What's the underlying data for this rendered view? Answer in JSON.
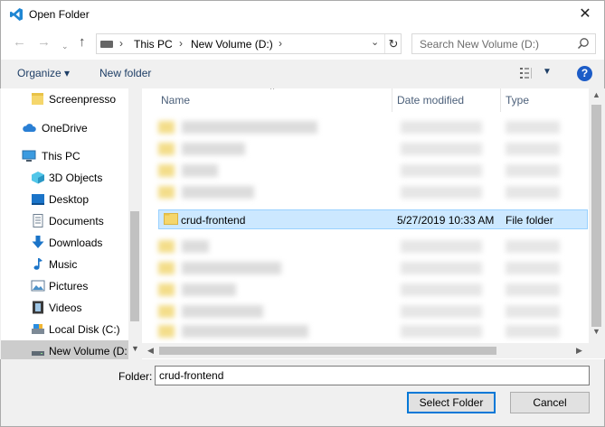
{
  "window": {
    "title": "Open Folder"
  },
  "address": {
    "crumbs": [
      "This PC",
      "New Volume (D:)"
    ],
    "search_placeholder": "Search New Volume (D:)"
  },
  "toolbar": {
    "organize": "Organize ▾",
    "new_folder": "New folder"
  },
  "nav": {
    "items": [
      {
        "label": "Screenpresso",
        "icon": "folder-icon"
      },
      {
        "label": "OneDrive",
        "icon": "cloud-icon"
      },
      {
        "label": "This PC",
        "icon": "computer-icon"
      },
      {
        "label": "3D Objects",
        "icon": "cube-icon"
      },
      {
        "label": "Desktop",
        "icon": "desktop-icon"
      },
      {
        "label": "Documents",
        "icon": "document-icon"
      },
      {
        "label": "Downloads",
        "icon": "download-arrow-icon"
      },
      {
        "label": "Music",
        "icon": "music-note-icon"
      },
      {
        "label": "Pictures",
        "icon": "pictures-icon"
      },
      {
        "label": "Videos",
        "icon": "film-icon"
      },
      {
        "label": "Local Disk (C:)",
        "icon": "disk-icon"
      },
      {
        "label": "New Volume (D:",
        "icon": "drive-icon",
        "selected": true
      }
    ]
  },
  "columns": {
    "name": "Name",
    "date": "Date modified",
    "type": "Type"
  },
  "selected_file": {
    "name": "crud-frontend",
    "date": "5/27/2019 10:33 AM",
    "type": "File folder"
  },
  "footer": {
    "folder_label": "Folder:",
    "folder_value": "crud-frontend",
    "select_button": "Select Folder",
    "cancel_button": "Cancel"
  },
  "colors": {
    "accent": "#0078d7",
    "selection": "#cce8ff",
    "help": "#1c5cc7"
  }
}
